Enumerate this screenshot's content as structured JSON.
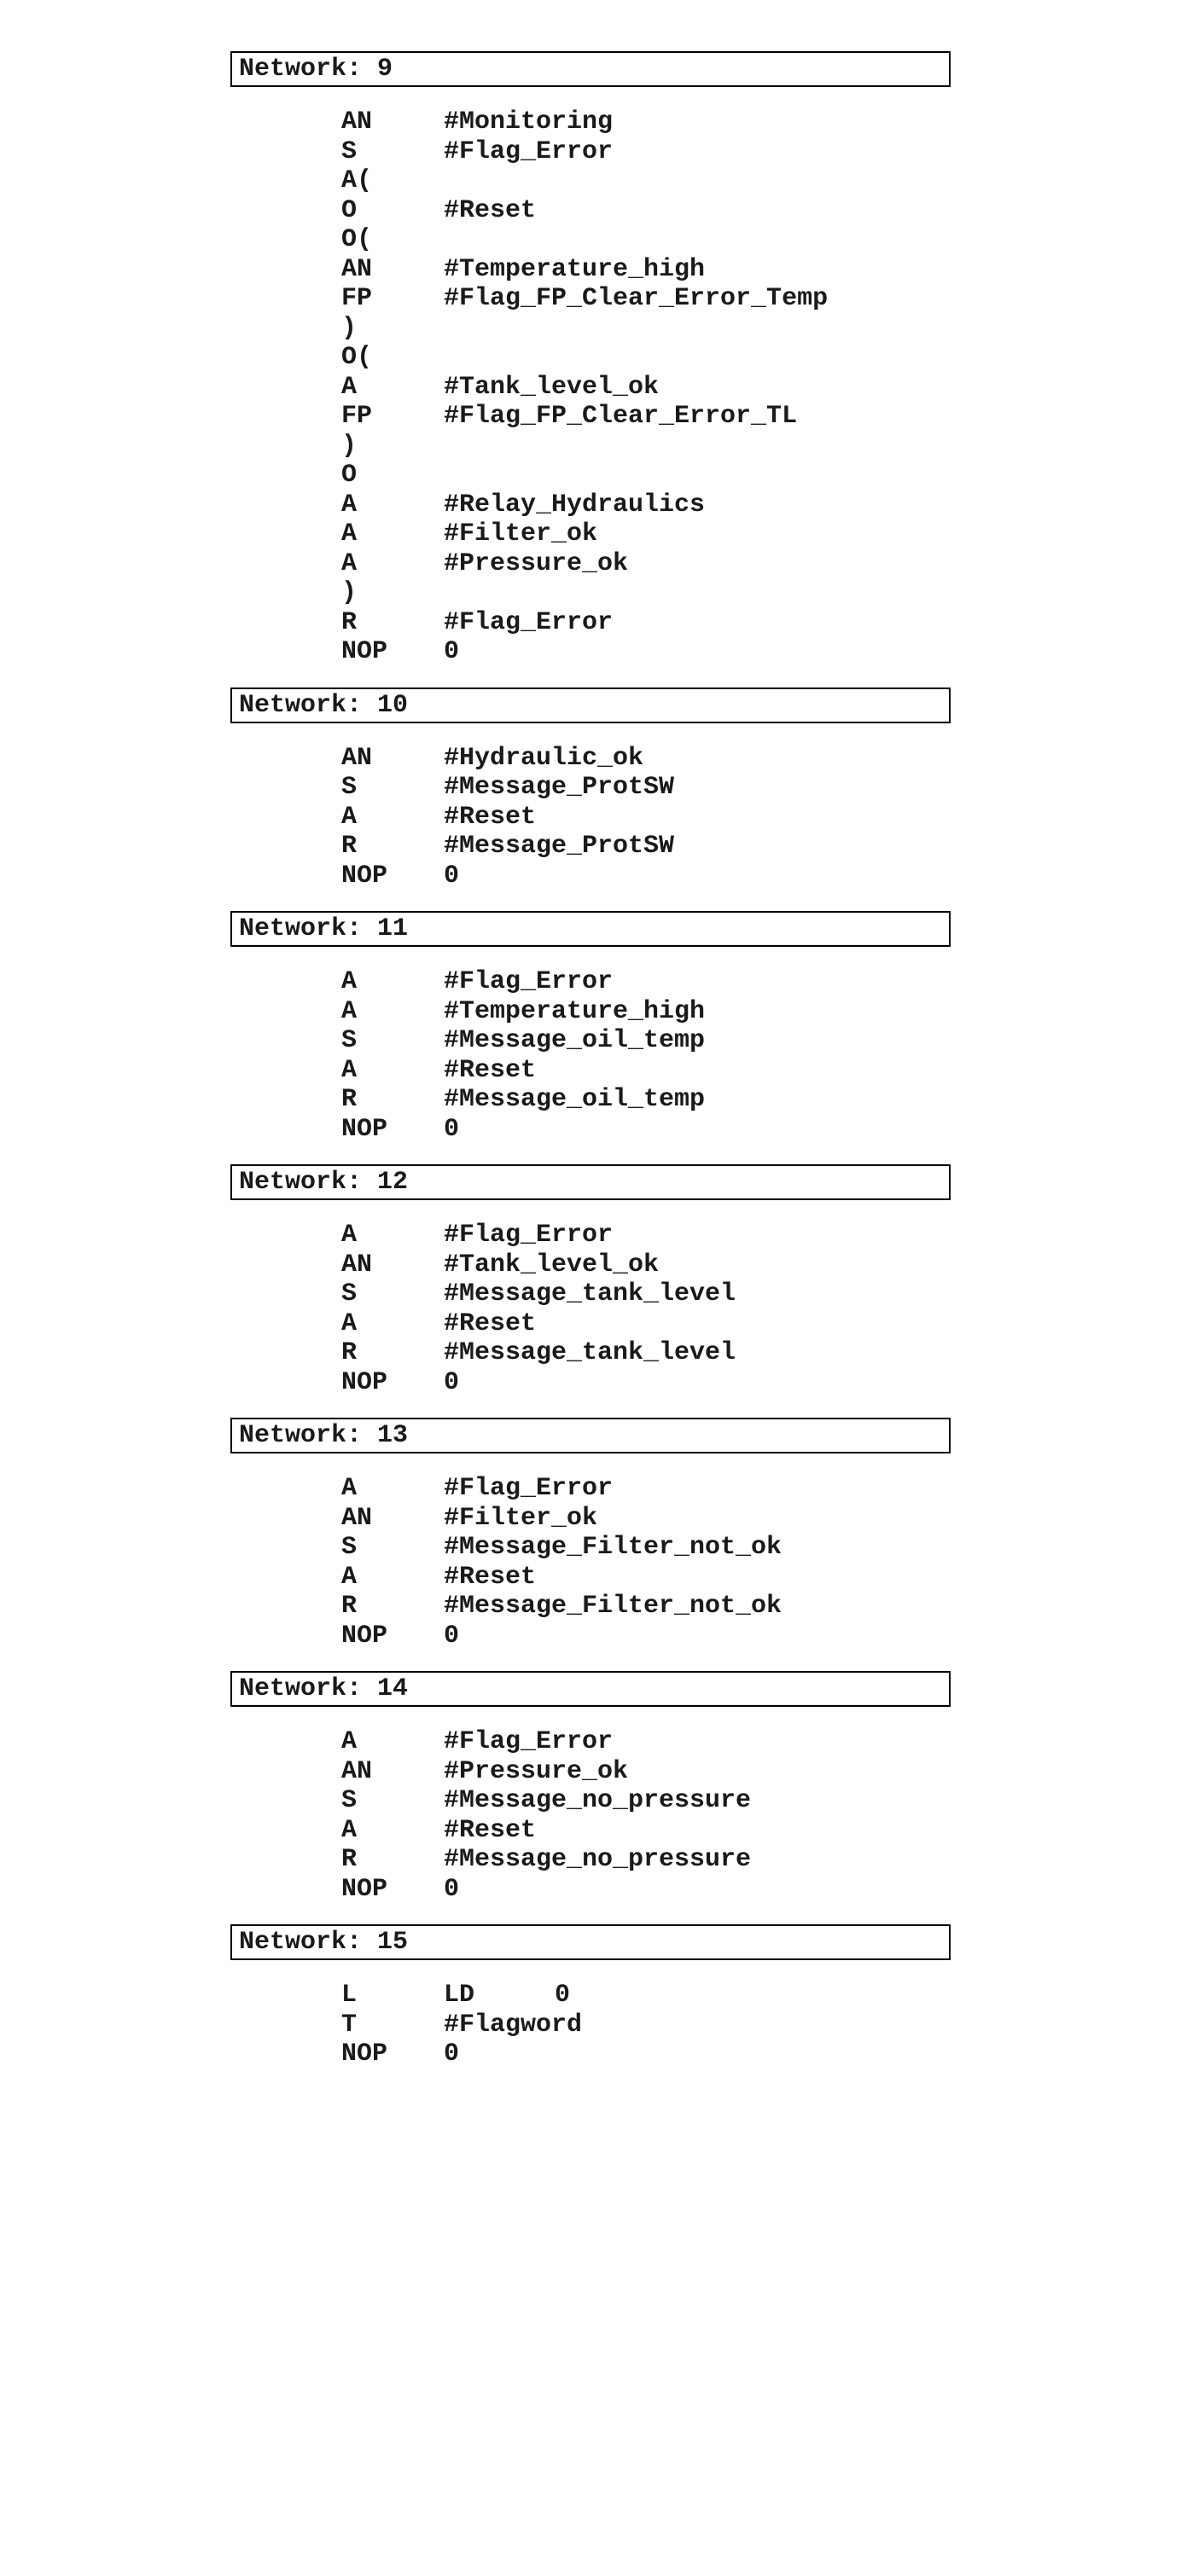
{
  "networks": [
    {
      "label": "Network: 9",
      "lines": [
        {
          "op": "AN",
          "arg": "#Monitoring"
        },
        {
          "op": "S",
          "arg": "#Flag_Error"
        },
        {
          "op": "A(",
          "arg": ""
        },
        {
          "op": "O",
          "arg": "#Reset"
        },
        {
          "op": "O(",
          "arg": ""
        },
        {
          "op": "AN",
          "arg": "#Temperature_high"
        },
        {
          "op": "FP",
          "arg": "#Flag_FP_Clear_Error_Temp"
        },
        {
          "op": ")",
          "arg": ""
        },
        {
          "op": "O(",
          "arg": ""
        },
        {
          "op": "A",
          "arg": "#Tank_level_ok"
        },
        {
          "op": "FP",
          "arg": "#Flag_FP_Clear_Error_TL"
        },
        {
          "op": ")",
          "arg": ""
        },
        {
          "op": "O",
          "arg": ""
        },
        {
          "op": "A",
          "arg": "#Relay_Hydraulics"
        },
        {
          "op": "A",
          "arg": "#Filter_ok"
        },
        {
          "op": "A",
          "arg": "#Pressure_ok"
        },
        {
          "op": ")",
          "arg": ""
        },
        {
          "op": "R",
          "arg": "#Flag_Error"
        },
        {
          "op": "NOP",
          "arg": "0"
        }
      ]
    },
    {
      "label": "Network: 10",
      "lines": [
        {
          "op": "AN",
          "arg": "#Hydraulic_ok"
        },
        {
          "op": "S",
          "arg": "#Message_ProtSW"
        },
        {
          "op": "A",
          "arg": "#Reset"
        },
        {
          "op": "R",
          "arg": "#Message_ProtSW"
        },
        {
          "op": "NOP",
          "arg": "0"
        }
      ]
    },
    {
      "label": "Network: 11",
      "lines": [
        {
          "op": "A",
          "arg": "#Flag_Error"
        },
        {
          "op": "A",
          "arg": "#Temperature_high"
        },
        {
          "op": "S",
          "arg": "#Message_oil_temp"
        },
        {
          "op": "A",
          "arg": "#Reset"
        },
        {
          "op": "R",
          "arg": "#Message_oil_temp"
        },
        {
          "op": "NOP",
          "arg": "0"
        }
      ]
    },
    {
      "label": "Network: 12",
      "lines": [
        {
          "op": "A",
          "arg": "#Flag_Error"
        },
        {
          "op": "AN",
          "arg": "#Tank_level_ok"
        },
        {
          "op": "S",
          "arg": "#Message_tank_level"
        },
        {
          "op": "A",
          "arg": "#Reset"
        },
        {
          "op": "R",
          "arg": "#Message_tank_level"
        },
        {
          "op": "NOP",
          "arg": "0"
        }
      ]
    },
    {
      "label": "Network: 13",
      "lines": [
        {
          "op": "A",
          "arg": "#Flag_Error"
        },
        {
          "op": "AN",
          "arg": "#Filter_ok"
        },
        {
          "op": "S",
          "arg": "#Message_Filter_not_ok"
        },
        {
          "op": "A",
          "arg": "#Reset"
        },
        {
          "op": "R",
          "arg": "#Message_Filter_not_ok"
        },
        {
          "op": "NOP",
          "arg": "0"
        }
      ]
    },
    {
      "label": "Network: 14",
      "lines": [
        {
          "op": "A",
          "arg": "#Flag_Error"
        },
        {
          "op": "AN",
          "arg": "#Pressure_ok"
        },
        {
          "op": "S",
          "arg": "#Message_no_pressure"
        },
        {
          "op": "A",
          "arg": "#Reset"
        },
        {
          "op": "R",
          "arg": "#Message_no_pressure"
        },
        {
          "op": "NOP",
          "arg": "0"
        }
      ]
    },
    {
      "label": "Network: 15",
      "lines": [
        {
          "op": "L",
          "sub_op": "LD",
          "arg": "0"
        },
        {
          "op": "T",
          "arg": "#Flagword"
        },
        {
          "op": "NOP",
          "arg": "0"
        }
      ]
    }
  ]
}
